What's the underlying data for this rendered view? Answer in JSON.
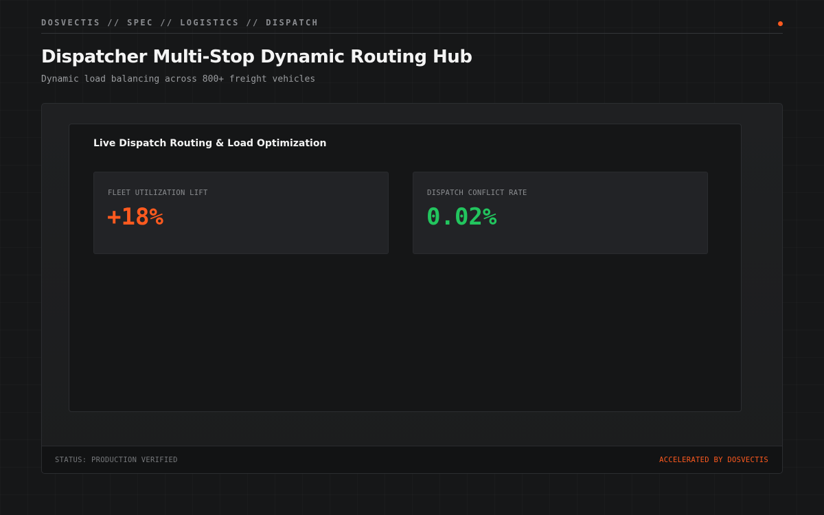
{
  "header": {
    "breadcrumb": "DOSVECTIS // SPEC // LOGISTICS // DISPATCH",
    "status_dot_color": "#ff5a1f"
  },
  "page": {
    "title": "Dispatcher Multi-Stop Dynamic Routing Hub",
    "subtitle": "Dynamic load balancing across 800+ freight vehicles"
  },
  "panel": {
    "title": "Live Dispatch Routing & Load Optimization",
    "metrics": [
      {
        "label": "FLEET UTILIZATION LIFT",
        "value": "+18%",
        "color": "#ff5a1f"
      },
      {
        "label": "DISPATCH CONFLICT RATE",
        "value": "0.02%",
        "color": "#22c55e"
      }
    ]
  },
  "footer": {
    "status": "STATUS: PRODUCTION VERIFIED",
    "credit": "ACCELERATED BY DOSVECTIS"
  },
  "colors": {
    "accent": "#ff5a1f",
    "success": "#22c55e",
    "background": "#161718"
  }
}
